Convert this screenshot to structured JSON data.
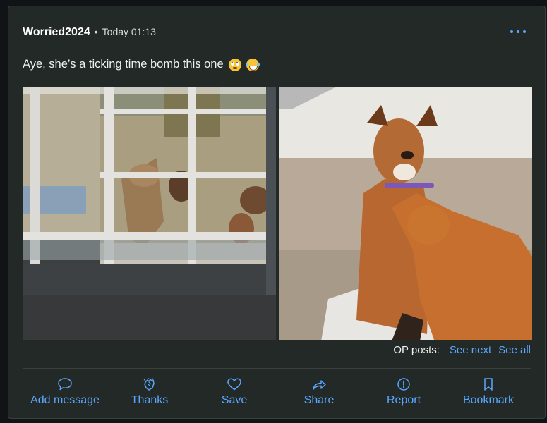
{
  "post": {
    "username": "Worried2024",
    "separator": "•",
    "timestamp": "Today 01:13",
    "message": "Aye, she’s a ticking time bomb this one",
    "emojis": [
      "face-with-rolling-eyes-emoji",
      "grinning-squinting-face-with-tears-emoji"
    ],
    "images": [
      {
        "alt": "Dog looking through glass door at chickens outside"
      },
      {
        "alt": "Brown dog sitting on sofa with ginger cat"
      }
    ]
  },
  "op_posts": {
    "label": "OP posts:",
    "see_next": "See next",
    "see_all": "See all"
  },
  "actions": [
    {
      "label": "Add message",
      "icon": "speech-bubble-icon"
    },
    {
      "label": "Thanks",
      "icon": "clap-icon"
    },
    {
      "label": "Save",
      "icon": "heart-icon"
    },
    {
      "label": "Share",
      "icon": "share-arrow-icon"
    },
    {
      "label": "Report",
      "icon": "alert-circle-icon"
    },
    {
      "label": "Bookmark",
      "icon": "bookmark-icon"
    }
  ],
  "colors": {
    "accent": "#5aa7ff",
    "card_background": "#232926",
    "page_background": "#111417"
  }
}
